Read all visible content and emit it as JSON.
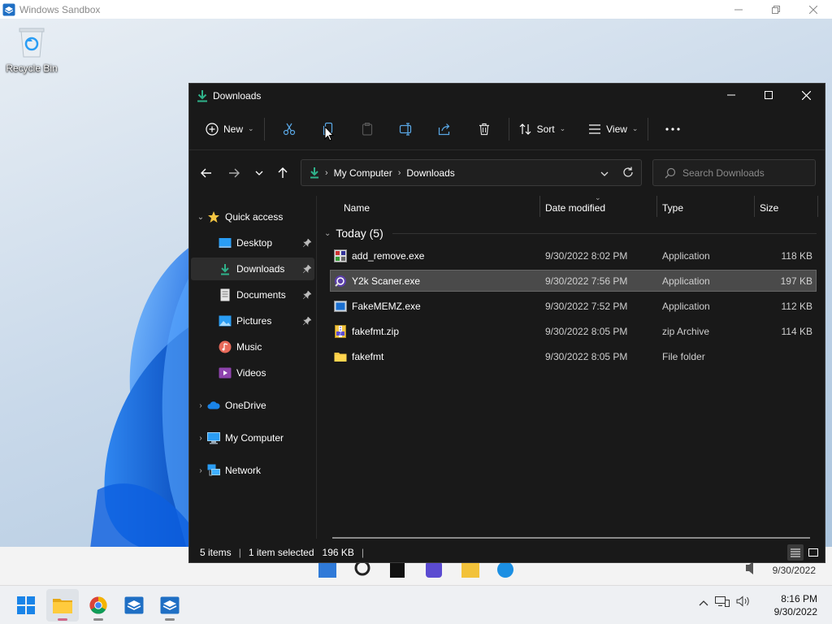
{
  "host": {
    "title": "Windows Sandbox",
    "controls": [
      "minimize",
      "restore",
      "close"
    ]
  },
  "desktop": {
    "recycle_bin_label": "Recycle Bin",
    "ghost_clock_date": "9/30/2022"
  },
  "explorer": {
    "title": "Downloads",
    "commands": {
      "new_label": "New",
      "sort_label": "Sort",
      "view_label": "View",
      "icons": [
        "scissors-icon",
        "copy-icon",
        "paste-icon",
        "rename-icon",
        "share-icon",
        "delete-icon",
        "more-icon"
      ]
    },
    "address": {
      "root": "My Computer",
      "current": "Downloads"
    },
    "search": {
      "placeholder": "Search Downloads"
    },
    "nav": {
      "quick_access": "Quick access",
      "items": [
        {
          "label": "Desktop",
          "icon": "desktop-icon",
          "pinned": true
        },
        {
          "label": "Downloads",
          "icon": "download-icon",
          "pinned": true,
          "selected": true
        },
        {
          "label": "Documents",
          "icon": "documents-icon",
          "pinned": true
        },
        {
          "label": "Pictures",
          "icon": "pictures-icon",
          "pinned": true
        },
        {
          "label": "Music",
          "icon": "music-icon",
          "pinned": false
        },
        {
          "label": "Videos",
          "icon": "videos-icon",
          "pinned": false
        }
      ],
      "onedrive": "OneDrive",
      "my_computer": "My Computer",
      "network": "Network"
    },
    "columns": {
      "name": "Name",
      "date": "Date modified",
      "type": "Type",
      "size": "Size"
    },
    "group": {
      "label": "Today (5)"
    },
    "files": [
      {
        "name": "add_remove.exe",
        "date": "9/30/2022 8:02 PM",
        "type": "Application",
        "size": "118 KB",
        "icon": "app-icon"
      },
      {
        "name": "Y2k Scaner.exe",
        "date": "9/30/2022 7:56 PM",
        "type": "Application",
        "size": "197 KB",
        "icon": "app-icon",
        "selected": true
      },
      {
        "name": "FakeMEMZ.exe",
        "date": "9/30/2022 7:52 PM",
        "type": "Application",
        "size": "112 KB",
        "icon": "app-icon"
      },
      {
        "name": "fakefmt.zip",
        "date": "9/30/2022 8:05 PM",
        "type": "zip Archive",
        "size": "114 KB",
        "icon": "zip-icon"
      },
      {
        "name": "fakefmt",
        "date": "9/30/2022 8:05 PM",
        "type": "File folder",
        "size": "",
        "icon": "folder-icon"
      }
    ],
    "status": {
      "items": "5 items",
      "selected": "1 item selected",
      "size": "196 KB"
    }
  },
  "taskbar": {
    "time": "8:16 PM",
    "date": "9/30/2022",
    "apps": [
      "start-icon",
      "file-explorer-icon",
      "chrome-icon",
      "sandbox-icon",
      "sandbox-icon"
    ]
  },
  "colors": {
    "accent_green": "#2fb28a",
    "explorer_bg": "#191919",
    "selection": "#4a4a4a",
    "folder_yellow": "#f4c542",
    "win_blue": "#1a84e8"
  }
}
